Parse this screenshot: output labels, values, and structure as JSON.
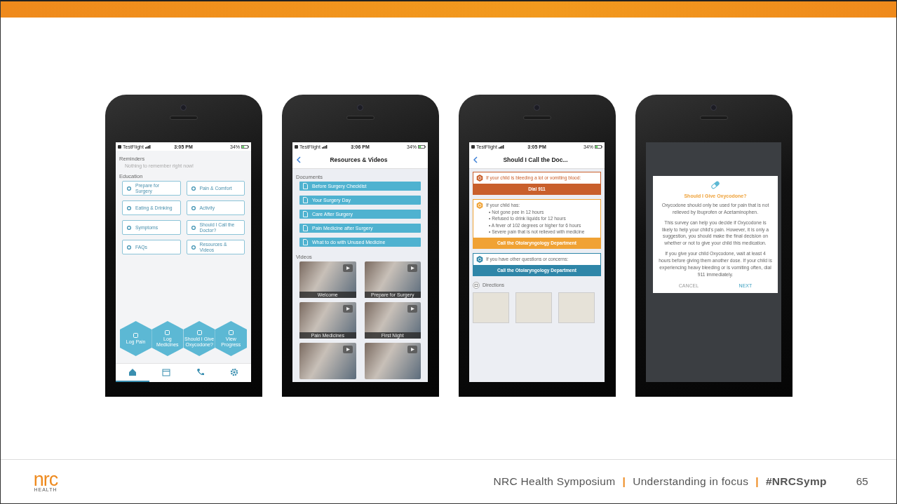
{
  "slide": {
    "phones": [
      {
        "kind": "home",
        "status": {
          "app": "TestFlight",
          "time": "3:05 PM",
          "battery": "34%"
        },
        "reminders": {
          "title": "Reminders",
          "empty_text": "Nothing to remember right now!"
        },
        "education": {
          "title": "Education",
          "items": [
            {
              "label": "Prepare for Surgery"
            },
            {
              "label": "Pain & Comfort"
            },
            {
              "label": "Eating & Drinking"
            },
            {
              "label": "Activity"
            },
            {
              "label": "Symptoms"
            },
            {
              "label": "Should I Call the Doctor?"
            },
            {
              "label": "FAQs"
            },
            {
              "label": "Resources & Videos"
            }
          ]
        },
        "actions": [
          {
            "label": "Log Pain"
          },
          {
            "label": "Log Medicines"
          },
          {
            "label": "Should I Give Oxycodone?"
          },
          {
            "label": "View Progress"
          }
        ],
        "tabs": [
          {
            "kind": "home",
            "selected": true
          },
          {
            "kind": "calendar",
            "selected": false
          },
          {
            "kind": "phone",
            "selected": false
          },
          {
            "kind": "settings",
            "selected": false
          }
        ]
      },
      {
        "kind": "resources",
        "status": {
          "app": "TestFlight",
          "time": "3:06 PM",
          "battery": "34%"
        },
        "title": "Resources & Videos",
        "documents": {
          "title": "Documents",
          "items": [
            {
              "label": "Before Surgery Checklist"
            },
            {
              "label": "Your Surgery Day"
            },
            {
              "label": "Care After Surgery"
            },
            {
              "label": "Pain Medicine after Surgery"
            },
            {
              "label": "What to do with Unused Medicine"
            }
          ]
        },
        "videos": {
          "title": "Videos",
          "items": [
            {
              "kind": "full",
              "caption": "Welcome"
            },
            {
              "kind": "full",
              "caption": "Prepare for Surgery"
            },
            {
              "kind": "full",
              "caption": "Pain Medicines"
            },
            {
              "kind": "full",
              "caption": "First Night"
            },
            {
              "kind": "partial"
            },
            {
              "kind": "partial"
            }
          ]
        }
      },
      {
        "kind": "call",
        "status": {
          "app": "TestFlight",
          "time": "3:05 PM",
          "battery": "34%"
        },
        "title": "Should I Call the Doc...",
        "cards": [
          {
            "kind": "alert",
            "color": "#c95f2b",
            "intro": "If your child is bleeding a lot or vomiting blood:",
            "button": "Dial 911"
          },
          {
            "kind": "list",
            "color": "#f0a234",
            "intro": "If your child has:",
            "bullets": [
              "• Not gone pee in 12 hours",
              "• Refused to drink liquids for 12 hours",
              "• A fever of 102 degrees or higher for 6 hours",
              "• Severe pain that is not relieved with medicine"
            ],
            "button": "Call the Otolaryngology Department"
          },
          {
            "kind": "info",
            "color": "#2f86a8",
            "intro": "If you have other questions or concerns:",
            "button": "Call the Otolaryngology Department"
          }
        ],
        "directions": "Directions"
      },
      {
        "kind": "dialog",
        "dialog": {
          "title": "Should I Give Oxycodone?",
          "paragraphs": [
            "Oxycodone should only be used for pain that is not relieved by Ibuprofen or Acetaminophen.",
            "This survey can help you decide if Oxycodone is likely to help your child's pain. However, it is only a suggestion, you should make the final decision on whether or not to give your child this medication.",
            "If you give your child Oxycodone, wait at least 4 hours before giving them another dose. If your child is experiencing heavy bleeding or is vomiting often, dial 911 immediately."
          ],
          "buttons": [
            {
              "kind": "cancel",
              "label": "CANCEL"
            },
            {
              "kind": "next",
              "label": "NEXT"
            }
          ]
        }
      }
    ],
    "footer": {
      "logo": {
        "mark": "nrc",
        "subtitle": "HEALTH"
      },
      "items": [
        {
          "kind": "text",
          "text": "NRC Health Symposium"
        },
        {
          "kind": "separator",
          "text": "|"
        },
        {
          "kind": "text",
          "text": "Understanding in focus"
        },
        {
          "kind": "separator",
          "text": "|"
        },
        {
          "kind": "hashtag",
          "text": "#NRCSymp"
        }
      ],
      "page_number": "65"
    }
  }
}
